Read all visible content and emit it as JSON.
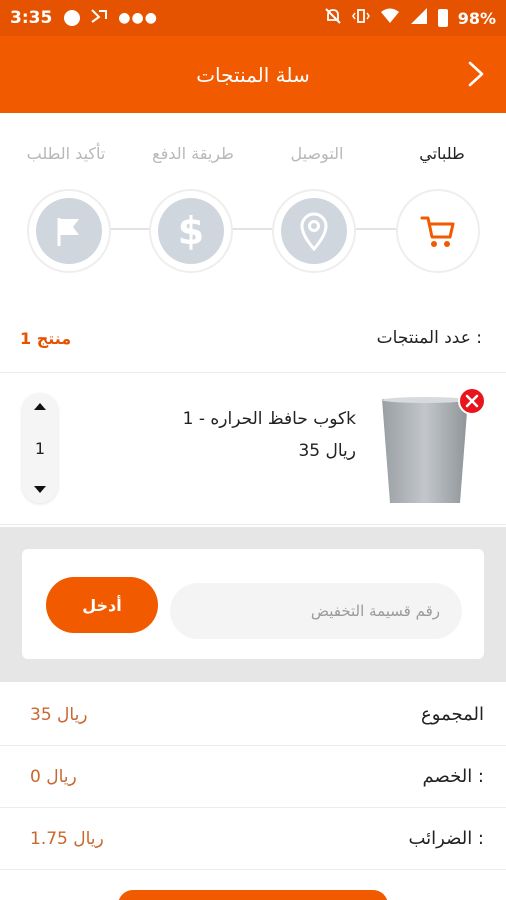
{
  "status_bar": {
    "time": "3:35",
    "battery_percent": "98%",
    "left_icons": [
      "circle-icon",
      "sim-icon",
      "dots-icon"
    ],
    "right_icons": [
      "mute-icon",
      "vibrate-icon",
      "wifi-icon",
      "signal-icon",
      "battery-icon"
    ]
  },
  "header": {
    "title": "سلة المنتجات",
    "back_icon": "chevron-right-icon"
  },
  "steps": [
    {
      "label": "طلباتي",
      "icon": "cart-icon",
      "active": true
    },
    {
      "label": "التوصيل",
      "icon": "location-pin-icon",
      "active": false
    },
    {
      "label": "طريقة الدفع",
      "icon": "dollar-icon",
      "active": false
    },
    {
      "label": "تأكيد الطلب",
      "icon": "flag-icon",
      "active": false
    }
  ],
  "product_count": {
    "label": "عدد المنتجات :",
    "value": "1 منتج"
  },
  "cart_item": {
    "name": "كوب حافظ الحراره - 1k",
    "price": "35 ريال",
    "quantity": "1"
  },
  "coupon": {
    "placeholder": "رقم قسيمة التخفيض",
    "button_label": "أدخل"
  },
  "totals": [
    {
      "label": "المجموع",
      "value": "35 ريال"
    },
    {
      "label": "الخصم :",
      "value": "0 ريال"
    },
    {
      "label": "الضرائب :",
      "value": "1.75 ريال"
    }
  ],
  "colors": {
    "primary": "#f25a00",
    "status_bar": "#e55300",
    "remove": "#e8161c",
    "step_inactive": "#cfd6de"
  }
}
